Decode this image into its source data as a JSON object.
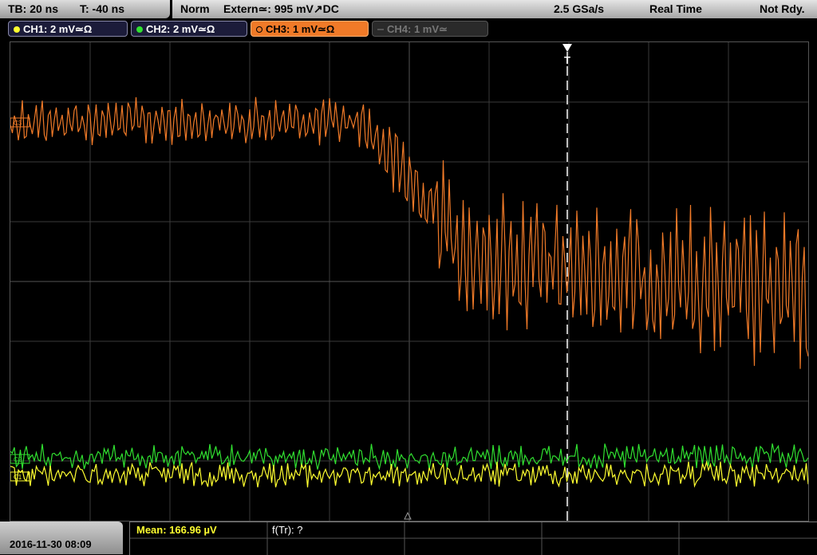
{
  "header": {
    "tb_label": "TB: 20 ns",
    "t_label": "T: -40 ns",
    "mode": "Norm",
    "trigger": "Extern≃: 995 mV↗DC",
    "sample_rate": "2.5 GSa/s",
    "acq_mode": "Real Time",
    "status": "Not Rdy."
  },
  "channels": [
    {
      "label": "CH1: 2 mV≃Ω",
      "color": "#ffff30",
      "active": true
    },
    {
      "label": "CH2: 2 mV≃Ω",
      "color": "#30e030",
      "active": true
    },
    {
      "label": "CH3: 1 mV≃Ω",
      "color": "#f07a28",
      "active": true
    },
    {
      "label": "CH4: 1 mV≃",
      "color": "#777777",
      "active": false
    }
  ],
  "trigger_marker": "T",
  "footer": {
    "datetime": "2016-11-30 08:09",
    "mean": "Mean: 166.96 µV",
    "ftr": "f(Tr): ?"
  },
  "colors": {
    "grid": "#3a3a3a",
    "ch1": "#ffff30",
    "ch2": "#30e030",
    "ch3": "#f07a28"
  }
}
